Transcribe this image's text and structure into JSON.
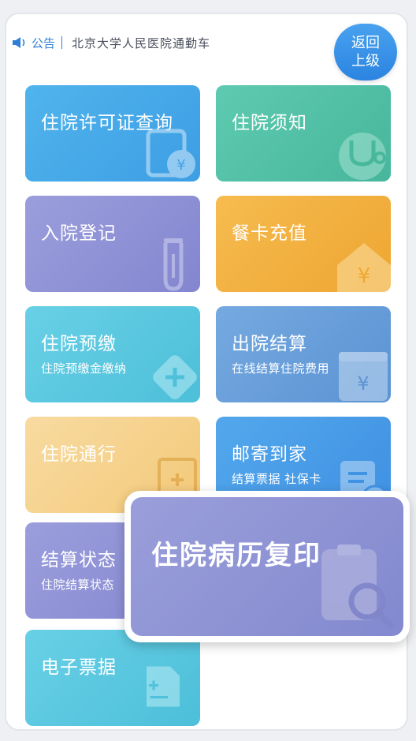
{
  "notice": {
    "label": "公告",
    "text": "北京大学人民医院通勤车"
  },
  "back_button": {
    "line1": "返回",
    "line2": "上级"
  },
  "tiles": [
    {
      "title": "住院许可证查询",
      "subtitle": "",
      "icon": "document-yuan-icon",
      "color": "#45a6e8"
    },
    {
      "title": "住院须知",
      "subtitle": "",
      "icon": "stethoscope-icon",
      "color": "#52c1a7"
    },
    {
      "title": "入院登记",
      "subtitle": "",
      "icon": "test-tube-icon",
      "color": "#8f92d6"
    },
    {
      "title": "餐卡充值",
      "subtitle": "",
      "icon": "house-yuan-icon",
      "color": "#f3b040"
    },
    {
      "title": "住院预缴",
      "subtitle": "住院预缴金缴纳",
      "icon": "plus-diamond-icon",
      "color": "#5cc8e0"
    },
    {
      "title": "出院结算",
      "subtitle": "在线结算住院费用",
      "icon": "calculator-yuan-icon",
      "color": "#6aa0da"
    },
    {
      "title": "住院通行",
      "subtitle": "",
      "icon": "pass-card-icon",
      "color": "#f6d28c"
    },
    {
      "title": "邮寄到家",
      "subtitle": "结算票据 社保卡",
      "icon": "mail-clock-icon",
      "color": "#4a9be8"
    },
    {
      "title": "结算状态",
      "subtitle": "住院结算状态",
      "icon": "status-icon",
      "color": "#8f92d6"
    },
    {
      "title": "电子票据",
      "subtitle": "",
      "icon": "receipt-icon",
      "color": "#5cc8e0"
    }
  ],
  "popup": {
    "title": "住院病历复印",
    "icon": "clipboard-search-icon"
  }
}
